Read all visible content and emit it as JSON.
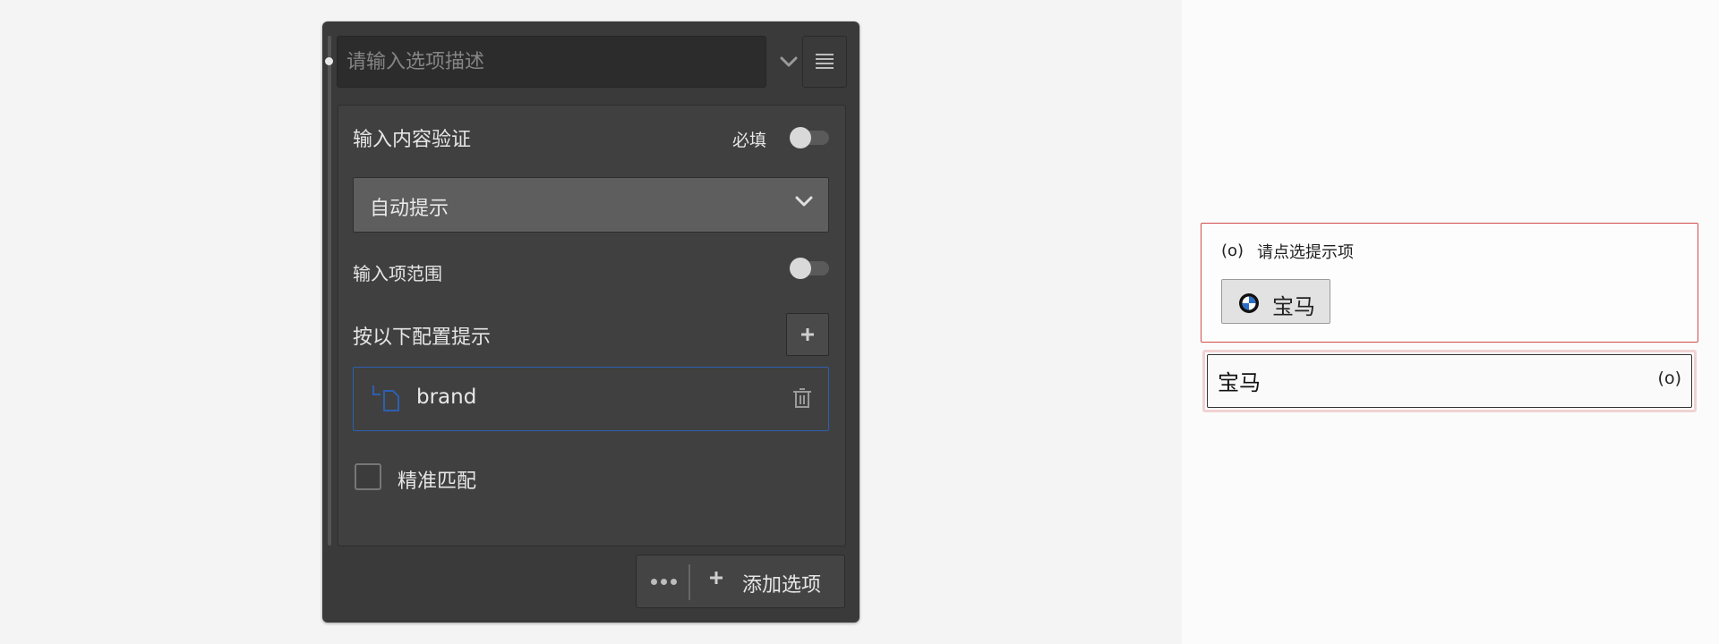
{
  "editor": {
    "description_placeholder": "请输入选项描述",
    "validation_label": "输入内容验证",
    "required_label": "必填",
    "required_on": false,
    "hint_mode_value": "自动提示",
    "input_range_label": "输入项范围",
    "input_range_on": false,
    "config_hint_label": "按以下配置提示",
    "field_name": "brand",
    "exact_match_label": "精准匹配",
    "exact_match_checked": false,
    "add_option_label": "添加选项"
  },
  "preview": {
    "hint_icon": "(o)",
    "hint_text": "请点选提示项",
    "chip_label": "宝马",
    "chip_icon": "bmw-logo-icon",
    "answer_value": "宝马",
    "answer_icon": "(o)"
  },
  "colors": {
    "panel_bg": "#3a3a3a",
    "selected_border": "#2d5fb0",
    "error_border": "#d24c4c"
  }
}
